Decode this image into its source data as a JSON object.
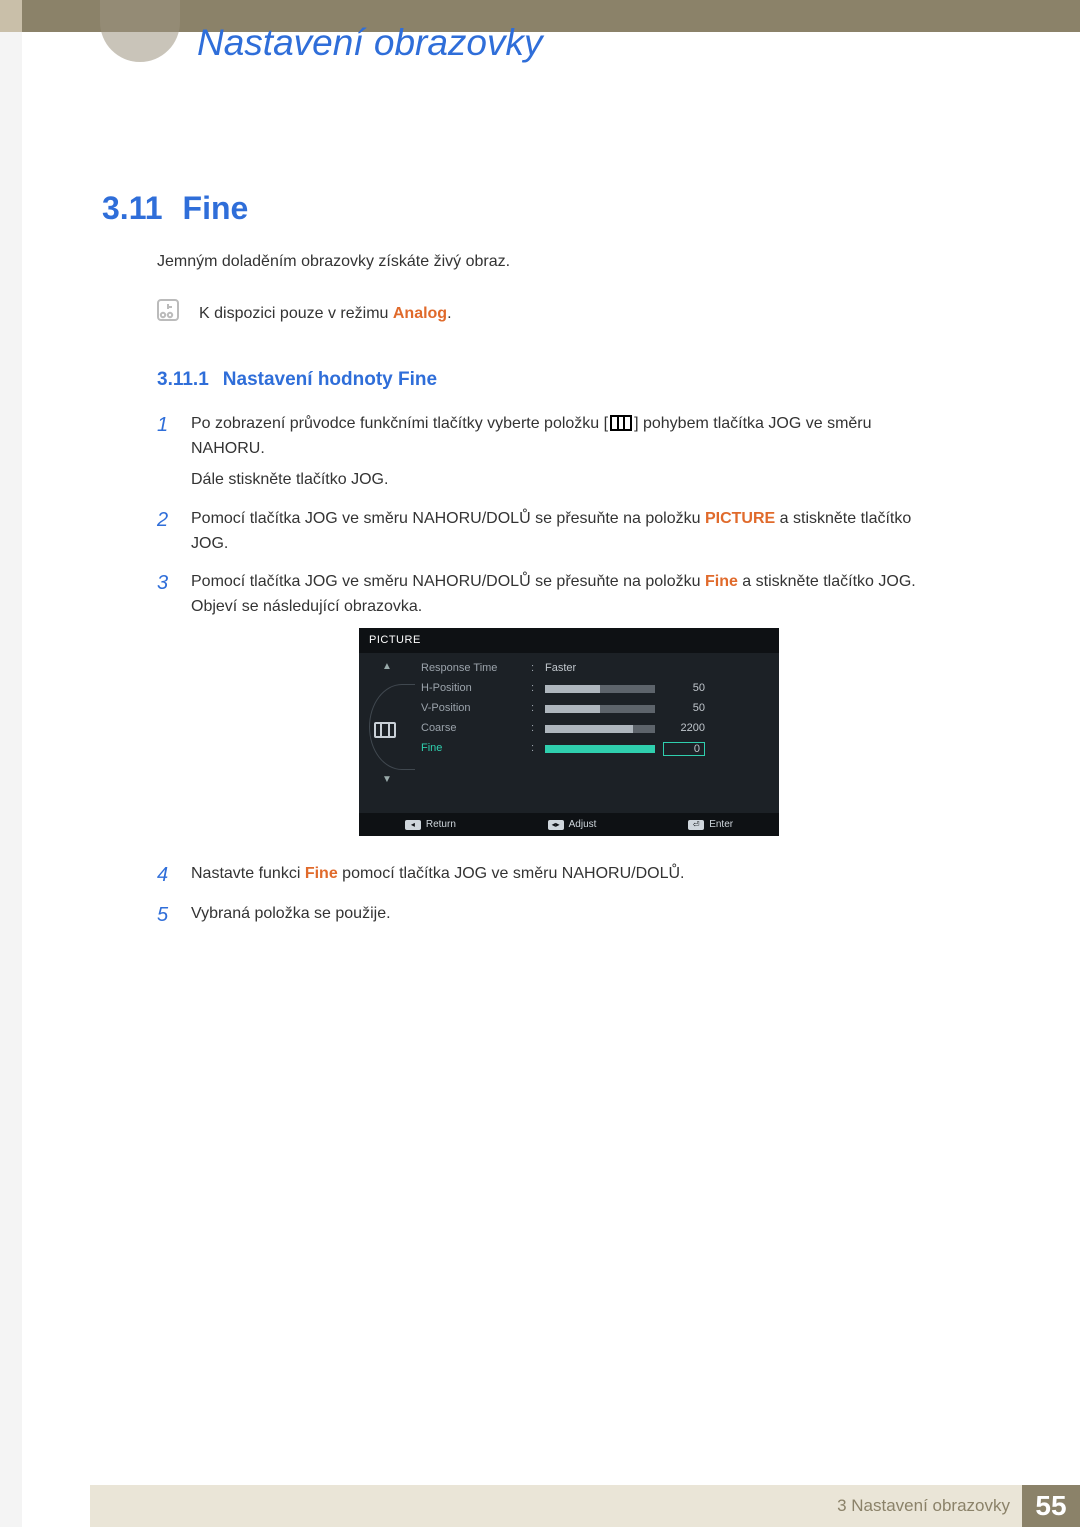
{
  "chapter": {
    "title": "Nastavení obrazovky"
  },
  "section": {
    "number": "3.11",
    "title": "Fine"
  },
  "intro": "Jemným doladěním obrazovky získáte živý obraz.",
  "note": {
    "prefix": "K dispozici pouze v režimu ",
    "highlight": "Analog",
    "suffix": "."
  },
  "subsection": {
    "number": "3.11.1",
    "title": "Nastavení hodnoty Fine"
  },
  "steps": {
    "n1": "1",
    "s1a": "Po zobrazení průvodce funkčními tlačítky vyberte položku [",
    "s1b": "] pohybem tlačítka JOG ve směru NAHORU.",
    "s1c": "Dále stiskněte tlačítko JOG.",
    "n2": "2",
    "s2a": "Pomocí tlačítka JOG ve směru NAHORU/DOLŮ se přesuňte na položku ",
    "s2hl": "PICTURE",
    "s2b": " a stiskněte tlačítko JOG.",
    "n3": "3",
    "s3a": "Pomocí tlačítka JOG ve směru NAHORU/DOLŮ se přesuňte na položku ",
    "s3hl": "Fine",
    "s3b": " a stiskněte tlačítko JOG. Objeví se následující obrazovka.",
    "n4": "4",
    "s4a": "Nastavte funkci ",
    "s4hl": "Fine",
    "s4b": " pomocí tlačítka JOG ve směru NAHORU/DOLŮ.",
    "n5": "5",
    "s5": "Vybraná položka se použije."
  },
  "osd": {
    "header": "PICTURE",
    "rows": {
      "response": {
        "label": "Response Time",
        "value": "Faster"
      },
      "hpos": {
        "label": "H-Position",
        "value": "50",
        "fill": 50
      },
      "vpos": {
        "label": "V-Position",
        "value": "50",
        "fill": 50
      },
      "coarse": {
        "label": "Coarse",
        "value": "2200",
        "fill": 80
      },
      "fine": {
        "label": "Fine",
        "value": "0",
        "fill": 100
      }
    },
    "footer": {
      "return": "Return",
      "adjust": "Adjust",
      "enter": "Enter"
    }
  },
  "footer": {
    "label": "3 Nastavení obrazovky",
    "page": "55"
  }
}
